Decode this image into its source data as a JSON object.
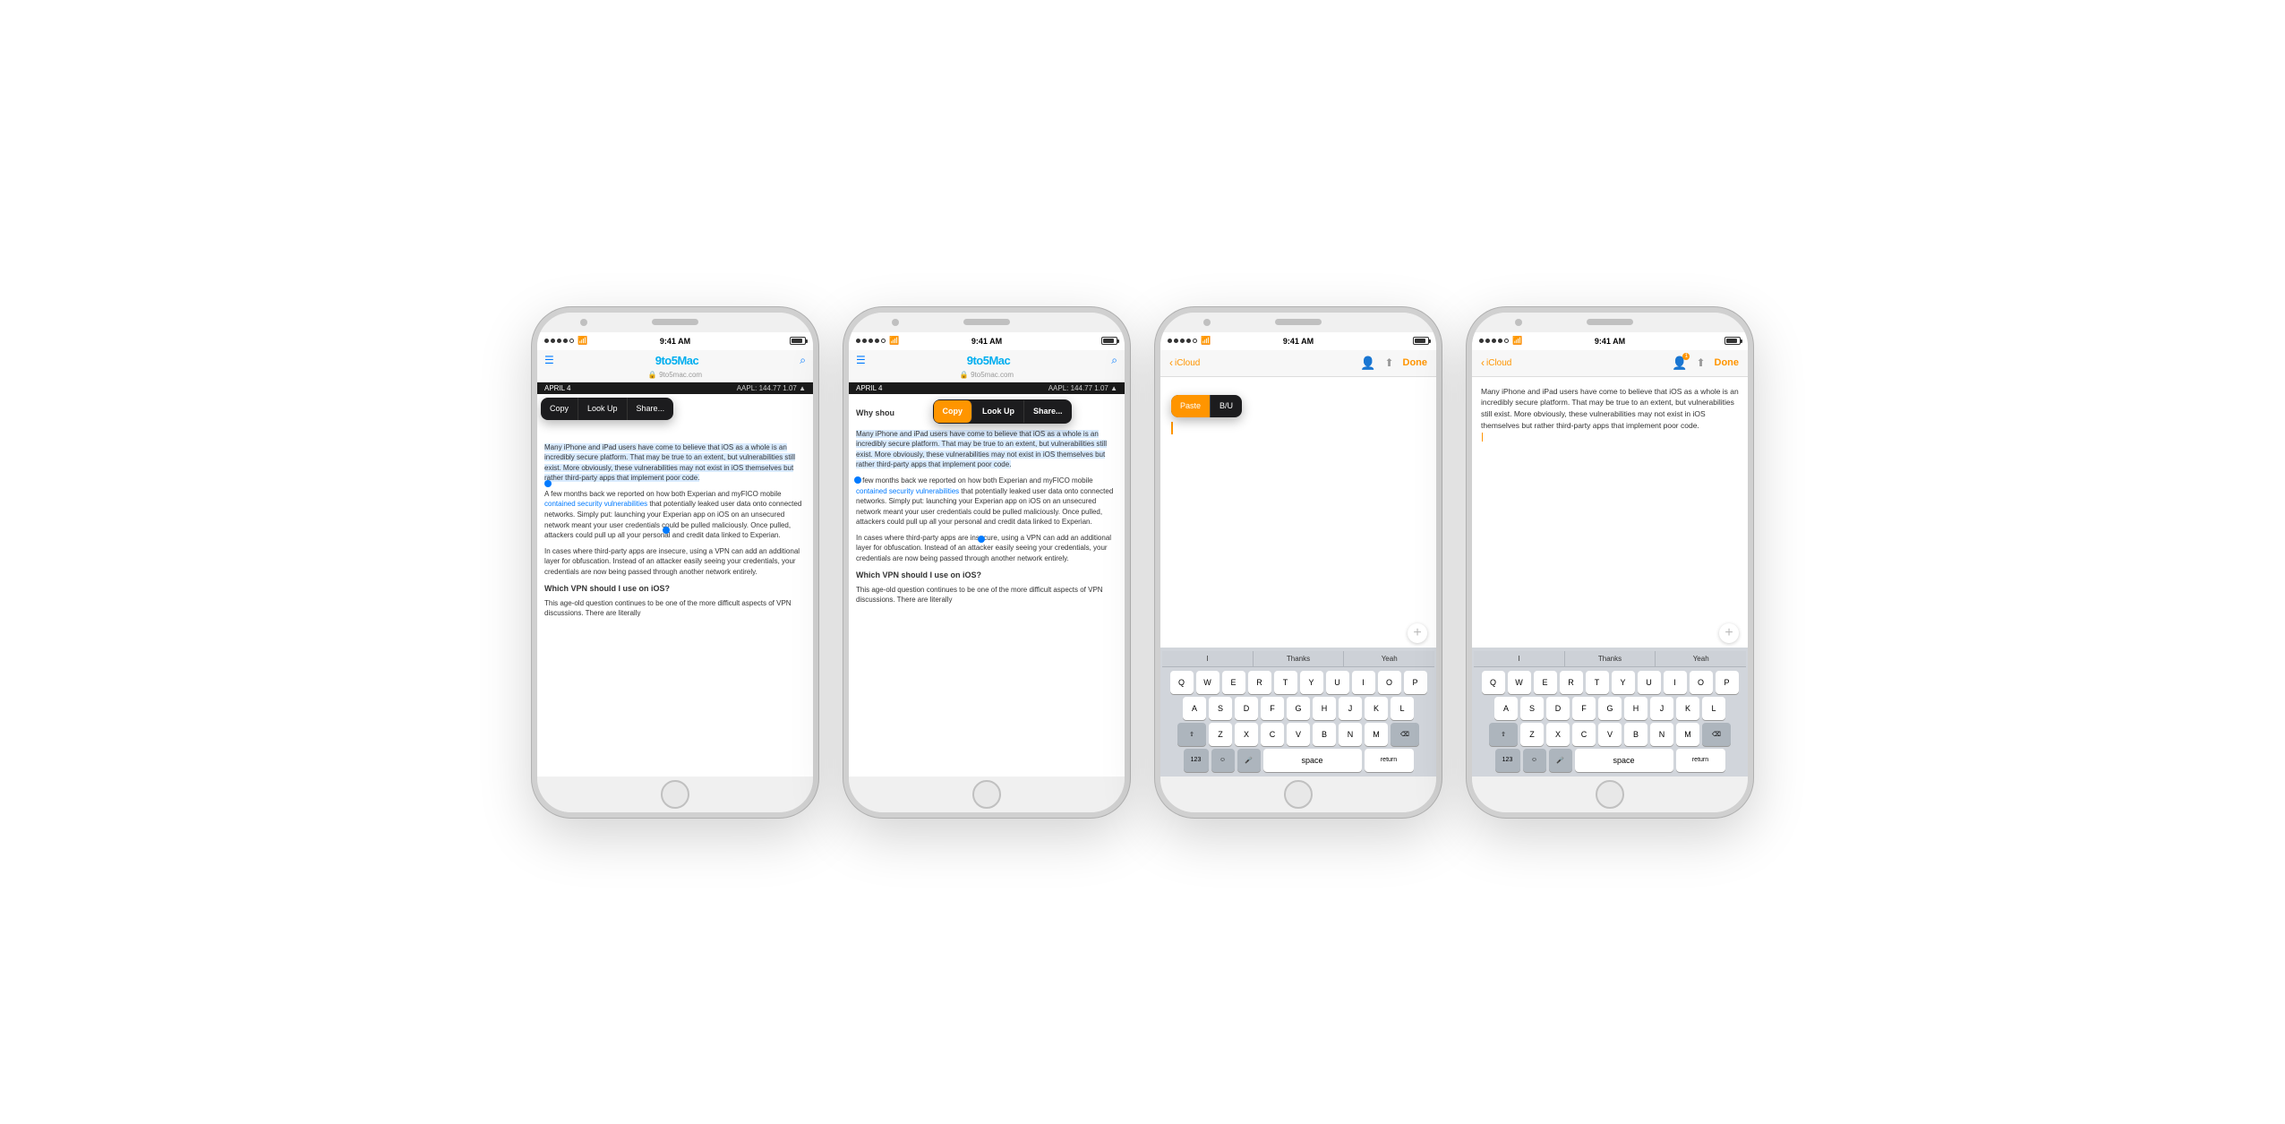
{
  "phones": [
    {
      "id": "phone1",
      "type": "safari",
      "statusBar": {
        "dots": 5,
        "time": "9:41 AM",
        "signal": "●●●●●",
        "wifi": true
      },
      "browser": {
        "url": "9to5mac.com",
        "siteTitle": "9to5Mac",
        "date": "APRIL 4",
        "stock": "AAPL: 144.77  1.07  ▲"
      },
      "contextMenu": {
        "items": [
          "Copy",
          "Look Up",
          "Share..."
        ],
        "visible": true,
        "highlighted": null
      },
      "article": {
        "paragraph1": "Many iPhone and iPad users have come to believe that iOS as a whole is an incredibly secure platform. That may be true to an extent, but vulnerabilities still exist. More obviously, these vulnerabilities may not exist in iOS themselves but rather third-party apps that implement poor code.",
        "paragraph2": "A few months back we reported on how both Experian and myFICO mobile contained security vulnerabilities that potentially leaked user data onto connected networks. Simply put: launching your Experian app on iOS on an unsecured network meant your user credentials could be pulled maliciously. Once pulled, attackers could pull up all your personal and credit data linked to Experian.",
        "paragraph3": "In cases where third-party apps are insecure, using a VPN can add an additional layer for obfuscation. Instead of an attacker easily seeing your credentials, your credentials are now being passed through another network entirely.",
        "heading": "Which VPN should I use on iOS?",
        "paragraph4": "This age-old question continues to be one of the more difficult aspects of VPN discussions. There are literally"
      }
    },
    {
      "id": "phone2",
      "type": "safari",
      "statusBar": {
        "time": "9:41 AM"
      },
      "browser": {
        "url": "9to5mac.com",
        "siteTitle": "9to5Mac",
        "date": "APRIL 4",
        "stock": "AAPL: 144.77  1.07  ▲"
      },
      "contextMenu": {
        "items": [
          "Copy",
          "Look Up",
          "Share..."
        ],
        "visible": true,
        "highlighted": "Copy"
      },
      "articleTitle": "Why shou",
      "article": {
        "paragraph1": "Many iPhone and iPad users have come to believe that iOS as a whole is an incredibly secure platform. That may be true to an extent, but vulnerabilities still exist. More obviously, these vulnerabilities may not exist in iOS themselves but rather third-party apps that implement poor code.",
        "selectedText": "Many iPhone and iPad users have come to believe that iOS as a whole is an incredibly secure platform. That may be true to an extent, but vulnerabilities still exist. More obviously, these vulnerabilities may not exist in iOS themselves but rather third-party apps that implement poor code.",
        "paragraph2": "A few months back we reported on how both Experian and myFICO mobile contained security vulnerabilities that potentially leaked user data onto connected networks. Simply put: launching your Experian app on iOS on an unsecured network meant your user credentials could be pulled maliciously. Once pulled, attackers could pull up all your personal and credit data linked to Experian.",
        "paragraph3": "In cases where third-party apps are insecure, using a VPN can add an additional layer for obfuscation. Instead of an attacker easily seeing your credentials, your credentials are now being passed through another network entirely.",
        "heading": "Which VPN should I use on iOS?",
        "paragraph4": "This age-old question continues to be one of the more difficult aspects of VPN discussions. There are literally"
      }
    },
    {
      "id": "phone3",
      "type": "notes",
      "statusBar": {
        "time": "9:41 AM"
      },
      "notesHeader": {
        "backLabel": "iCloud",
        "doneLabel": "Done"
      },
      "pasteMenu": {
        "items": [
          "Paste",
          "B/U"
        ],
        "visible": true,
        "highlighted": "Paste"
      },
      "hasKeyboard": true,
      "suggestions": [
        "I",
        "Thanks",
        "Yeah"
      ],
      "keys": {
        "row1": [
          "Q",
          "W",
          "E",
          "R",
          "T",
          "Y",
          "U",
          "I",
          "O",
          "P"
        ],
        "row2": [
          "A",
          "S",
          "D",
          "F",
          "G",
          "H",
          "J",
          "K",
          "L"
        ],
        "row3": [
          "Z",
          "X",
          "C",
          "V",
          "B",
          "N",
          "M"
        ],
        "bottom": [
          "123",
          "☺",
          "🎤",
          "space",
          "return"
        ]
      }
    },
    {
      "id": "phone4",
      "type": "notes",
      "statusBar": {
        "time": "9:41 AM"
      },
      "notesHeader": {
        "backLabel": "iCloud",
        "doneLabel": "Done"
      },
      "notesContent": "Many iPhone and iPad users have come to believe that iOS as a whole is an incredibly secure platform. That may be true to an extent, but vulnerabilities still exist. More obviously, these vulnerabilities may not exist in iOS themselves but rather third-party apps that implement poor code.",
      "hasKeyboard": true,
      "suggestions": [
        "I",
        "Thanks",
        "Yeah"
      ],
      "keys": {
        "row1": [
          "Q",
          "W",
          "E",
          "R",
          "T",
          "Y",
          "U",
          "I",
          "O",
          "P"
        ],
        "row2": [
          "A",
          "S",
          "D",
          "F",
          "G",
          "H",
          "J",
          "K",
          "L"
        ],
        "row3": [
          "Z",
          "X",
          "C",
          "V",
          "B",
          "N",
          "M"
        ],
        "bottom": [
          "123",
          "☺",
          "🎤",
          "space",
          "return"
        ]
      }
    }
  ],
  "contextMenuItems": {
    "copy": "Copy",
    "lookUp": "Look Up",
    "share": "Share..."
  },
  "pasteMenuItems": {
    "paste": "Paste",
    "bu": "B/U"
  },
  "colors": {
    "accent": "#007aff",
    "orange": "#ff9500",
    "siteBlue": "#00aeef",
    "selected": "rgba(0,122,255,0.2)"
  }
}
